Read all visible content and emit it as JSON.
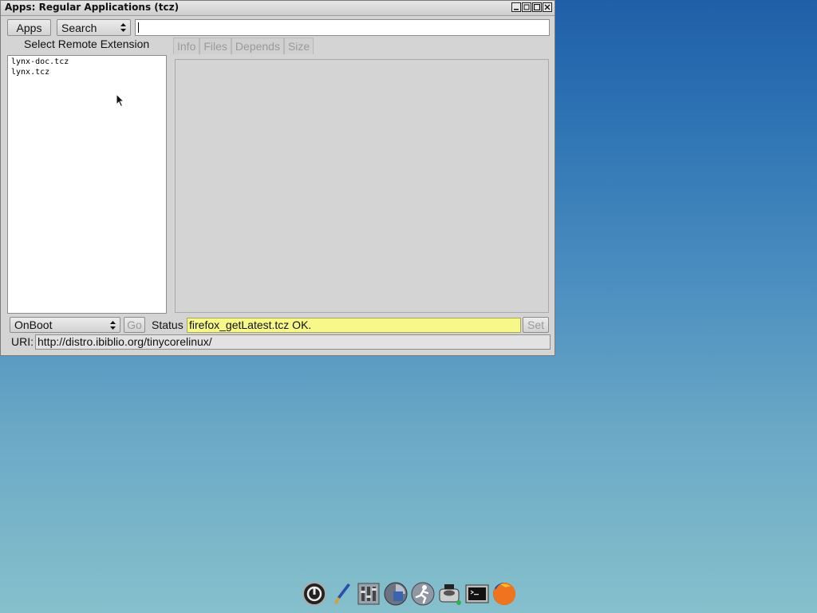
{
  "window": {
    "title": "Apps: Regular Applications (tcz)",
    "controls": [
      "minimize-icon",
      "restore-icon",
      "maximize-icon",
      "close-icon"
    ]
  },
  "toolbar": {
    "apps_label": "Apps",
    "search_mode": "Search",
    "search_value": ""
  },
  "left_panel": {
    "heading": "Select Remote Extension",
    "items": [
      "lynx-doc.tcz",
      "lynx.tcz"
    ]
  },
  "tabs": [
    "Info",
    "Files",
    "Depends",
    "Size"
  ],
  "bottom": {
    "install_mode": "OnBoot",
    "go_label": "Go",
    "status_label": "Status",
    "status_value": "firefox_getLatest.tcz OK.",
    "set_label": "Set",
    "uri_label": "URI:",
    "uri_value": "http://distro.ibiblio.org/tinycorelinux/"
  },
  "dock": {
    "icons": [
      "power-icon",
      "wallpaper-brush-icon",
      "control-panel-icon",
      "mount-tool-icon",
      "apps-run-icon",
      "tce-load-icon",
      "terminal-icon",
      "firefox-icon"
    ]
  },
  "colors": {
    "status_highlight": "#f7f78a",
    "desktop_top": "#1f5fa8",
    "desktop_bottom": "#86c0cc"
  }
}
